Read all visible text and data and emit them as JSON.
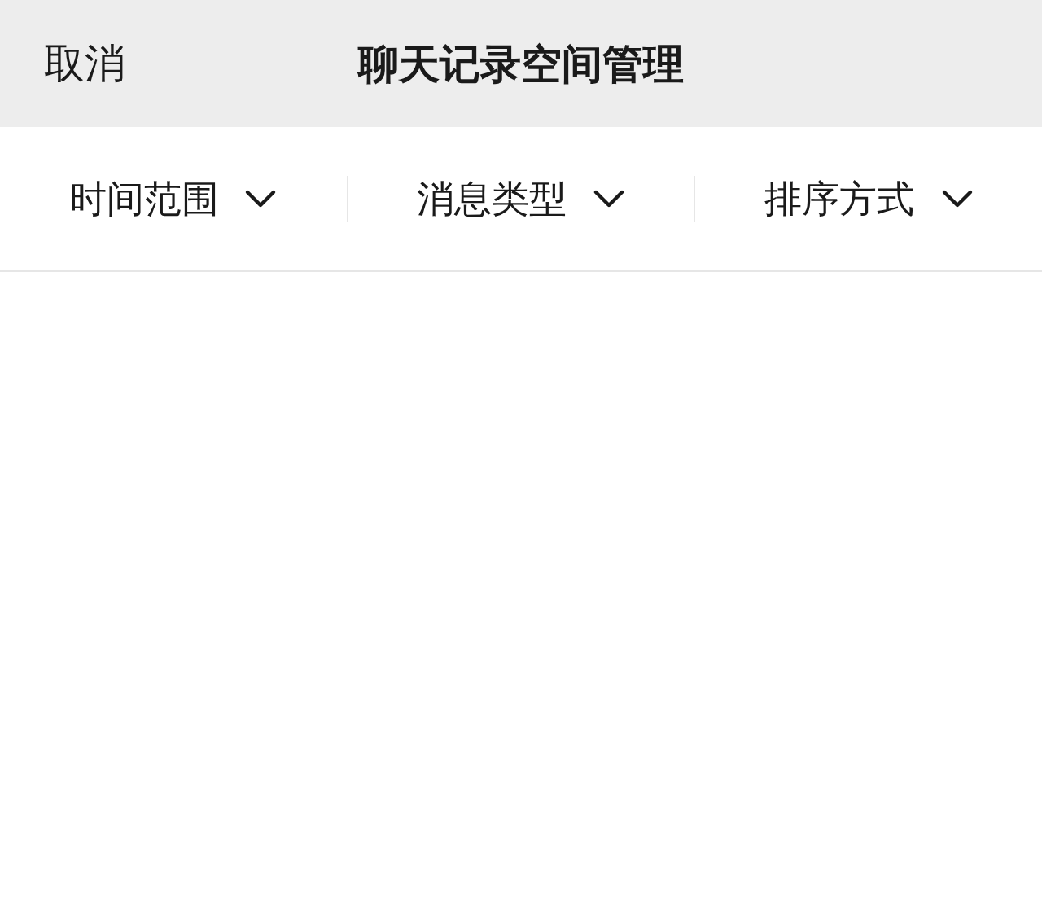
{
  "header": {
    "cancel": "取消",
    "title": "聊天记录空间管理"
  },
  "filters": [
    {
      "label": "时间范围"
    },
    {
      "label": "消息类型"
    },
    {
      "label": "排序方式"
    }
  ]
}
